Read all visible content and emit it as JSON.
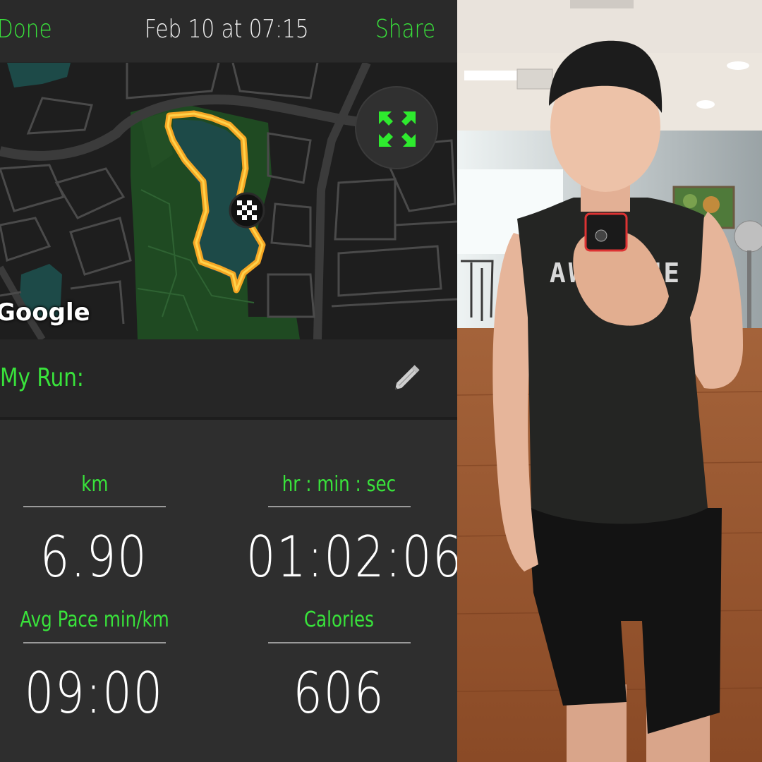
{
  "topbar": {
    "done_label": "Done",
    "title": "Feb 10 at 07:15",
    "share_label": "Share"
  },
  "map": {
    "attribution": "Google",
    "expand_icon": "expand-arrows-icon",
    "finish_icon": "checkered-flag-icon"
  },
  "run": {
    "name_label": "My Run:",
    "edit_icon": "pencil-icon"
  },
  "stats": [
    {
      "label": "km",
      "value": "6.90"
    },
    {
      "label": "hr : min : sec",
      "value": "01:02:06"
    },
    {
      "label": "Avg Pace min/km",
      "value": "09:00"
    },
    {
      "label": "Calories",
      "value": "606"
    }
  ],
  "photo": {
    "shirt_text": "AWESOME"
  },
  "colors": {
    "accent": "#39e33b",
    "background": "#2e2e2e",
    "route": "#f5a623"
  }
}
